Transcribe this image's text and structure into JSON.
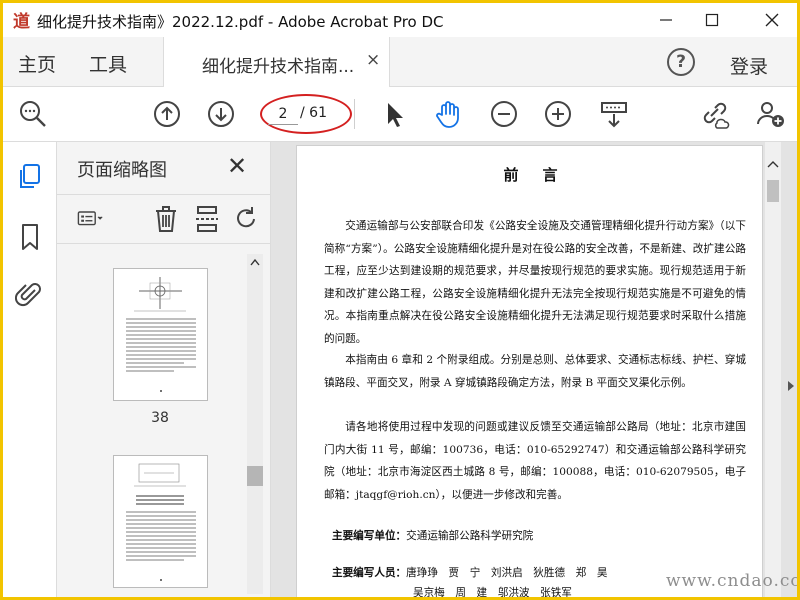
{
  "window": {
    "title": "细化提升技术指南》2022.12.pdf - Adobe Acrobat Pro DC",
    "minimize_label": "─",
    "maximize_label": "☐",
    "close_label": "✕"
  },
  "tabs": {
    "home": "主页",
    "tools": "工具",
    "document": "细化提升技术指南...",
    "document_close": "×",
    "help": "?",
    "login": "登录"
  },
  "toolbar": {
    "current_page": "2",
    "total_pages": "/ 61"
  },
  "thumbnails_panel": {
    "title": "页面缩略图",
    "close": "✕",
    "thumbs": [
      {
        "label": "38"
      },
      {
        "label": ""
      }
    ]
  },
  "document": {
    "heading": "前言",
    "paragraphs": [
      "交通运输部与公安部联合印发《公路安全设施及交通管理精细化提升行动方案》（以下简称“方案”）。公路安全设施精细化提升是对在役公路的安全改善，不是新建、改扩建公路工程，应至少达到建设期的规范要求，并尽量按现行规范的要求实施。现行规范适用于新建和改扩建公路工程，公路安全设施精细化提升无法完全按现行规范实施是不可避免的情况。本指南重点解决在役公路安全设施精细化提升无法满足现行规范要求时采取什么措施的问题。",
      "本指南由 6 章和 2 个附录组成。分别是总则、总体要求、交通标志标线、护栏、穿城镇路段、平面交叉，附录 A 穿城镇路段确定方法，附录 B 平面交叉渠化示例。",
      "请各地将使用过程中发现的问题或建议反馈至交通运输部公路局（地址：北京市建国门内大街 11 号，邮编：100736，电话：010-65292747）和交通运输部公路科学研究院（地址：北京市海淀区西土城路 8 号，邮编：100088，电话：010-62079505，电子邮箱：jtaqgf@rioh.cn），以便进一步修改和完善。"
    ],
    "editor_unit_label": "主要编写单位：",
    "editor_unit_value": "交通运输部公路科学研究院",
    "editors_label": "主要编写人员：",
    "editors_line1": "唐琤琤　贾　宁　刘洪启　狄胜德　郑　昊",
    "editors_line2": "吴京梅　周　建　邬洪波　张铁军"
  },
  "watermark": "www.cndao.com"
}
